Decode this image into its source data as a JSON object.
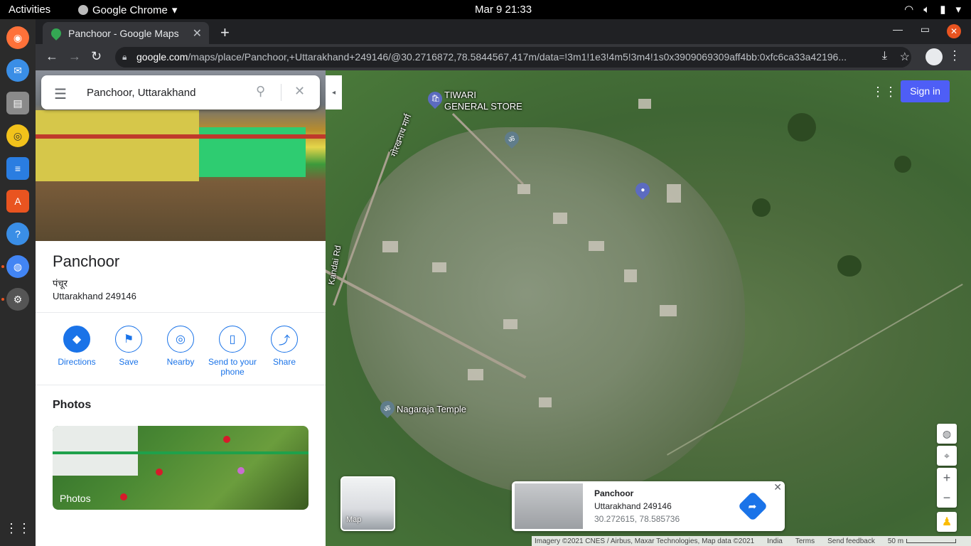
{
  "topbar": {
    "activities": "Activities",
    "app_name": "Google Chrome",
    "datetime": "Mar 9  21:33"
  },
  "dock": {
    "items": [
      "firefox-icon",
      "thunderbird-icon",
      "files-icon",
      "rhythmbox-icon",
      "writer-icon",
      "software-icon",
      "help-icon",
      "chrome-icon",
      "settings-icon",
      "show-apps-icon"
    ]
  },
  "browser": {
    "tab_title": "Panchoor - Google Maps",
    "url_host": "google.com",
    "url_path": "/maps/place/Panchoor,+Uttarakhand+249146/@30.2716872,78.5844567,417m/data=!3m1!1e3!4m5!3m4!1s0x3909069309aff4bb:0xfc6ca33a42196..."
  },
  "panel": {
    "search_query": "Panchoor, Uttarakhand",
    "place_title": "Panchoor",
    "place_local_name": "पंचूर",
    "place_address": "Uttarakhand 249146",
    "actions": [
      {
        "label": "Directions",
        "icon": "directions-icon"
      },
      {
        "label": "Save",
        "icon": "bookmark-icon"
      },
      {
        "label": "Nearby",
        "icon": "nearby-icon"
      },
      {
        "label": "Send to your phone",
        "icon": "phone-icon"
      },
      {
        "label": "Share",
        "icon": "share-icon"
      }
    ],
    "photos_heading": "Photos",
    "photos_card_label": "Photos"
  },
  "map": {
    "sign_in": "Sign in",
    "labels": {
      "store": "TIWARI\nGENERAL STORE",
      "temple": "Nagaraja Temple",
      "road_hindi": "गोरखनाथ मार्ग",
      "road_rd": "Kandai Rd"
    },
    "minimap_label": "Map",
    "infocard": {
      "name": "Panchoor",
      "address": "Uttarakhand 249146",
      "coords": "30.272615, 78.585736"
    },
    "footer": {
      "imagery": "Imagery ©2021 CNES / Airbus, Maxar Technologies, Map data ©2021",
      "region": "India",
      "terms": "Terms",
      "feedback": "Send feedback",
      "scale": "50 m"
    }
  },
  "colors": {
    "accent": "#1a73e8",
    "signin": "#4e5ef6",
    "ubuntu_orange": "#e95420"
  }
}
